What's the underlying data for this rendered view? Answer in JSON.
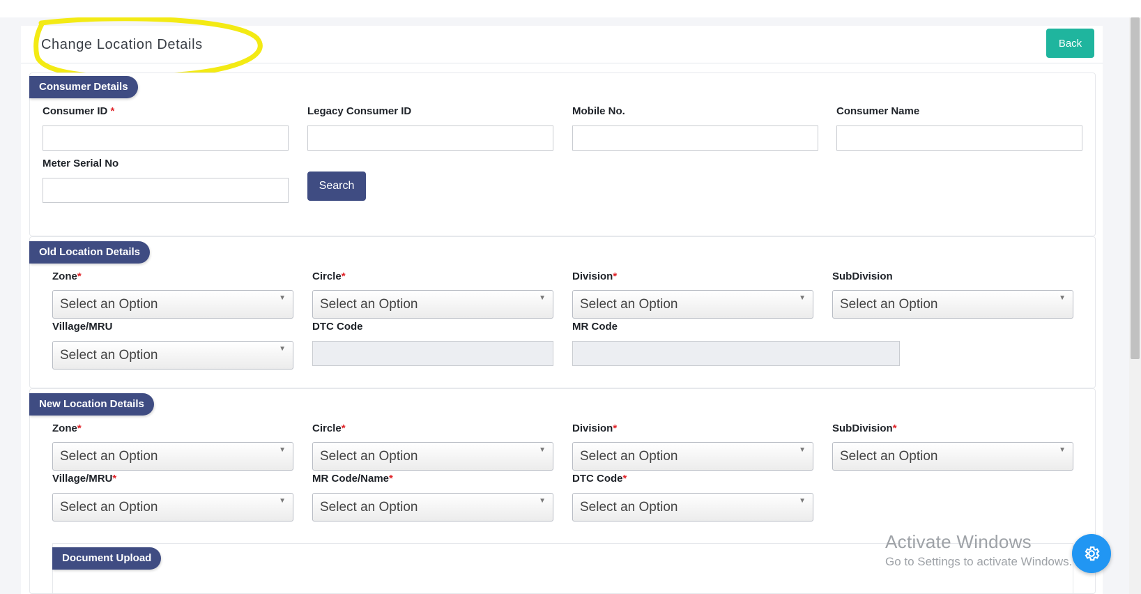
{
  "header": {
    "title": "Change Location Details",
    "back_label": "Back"
  },
  "consumer": {
    "tag": "Consumer Details",
    "consumer_id_label": "Consumer ID",
    "legacy_id_label": "Legacy Consumer ID",
    "mobile_label": "Mobile No.",
    "name_label": "Consumer Name",
    "meter_label": "Meter Serial No",
    "search_label": "Search"
  },
  "old_location": {
    "tag": "Old Location Details",
    "zone_label": "Zone",
    "circle_label": "Circle",
    "division_label": "Division",
    "subdivision_label": "SubDivision",
    "village_label": "Village/MRU",
    "dtc_label": "DTC Code",
    "mr_label": "MR Code"
  },
  "new_location": {
    "tag": "New Location Details",
    "zone_label": "Zone",
    "circle_label": "Circle",
    "division_label": "Division",
    "subdivision_label": "SubDivision",
    "village_label": "Village/MRU",
    "mr_label": "MR Code/Name",
    "dtc_label": "DTC Code"
  },
  "select_placeholder": "Select an Option",
  "required_mark": "*",
  "document": {
    "tag": "Document Upload"
  },
  "watermark": {
    "title": "Activate Windows",
    "subtitle": "Go to Settings to activate Windows."
  },
  "colors": {
    "accent": "#3f4c82",
    "back": "#1fb59e",
    "fab": "#2196f3",
    "highlight": "#f3ea14"
  },
  "icons": {
    "fab": "gear-icon",
    "dropdown": "chevron-down-icon"
  }
}
